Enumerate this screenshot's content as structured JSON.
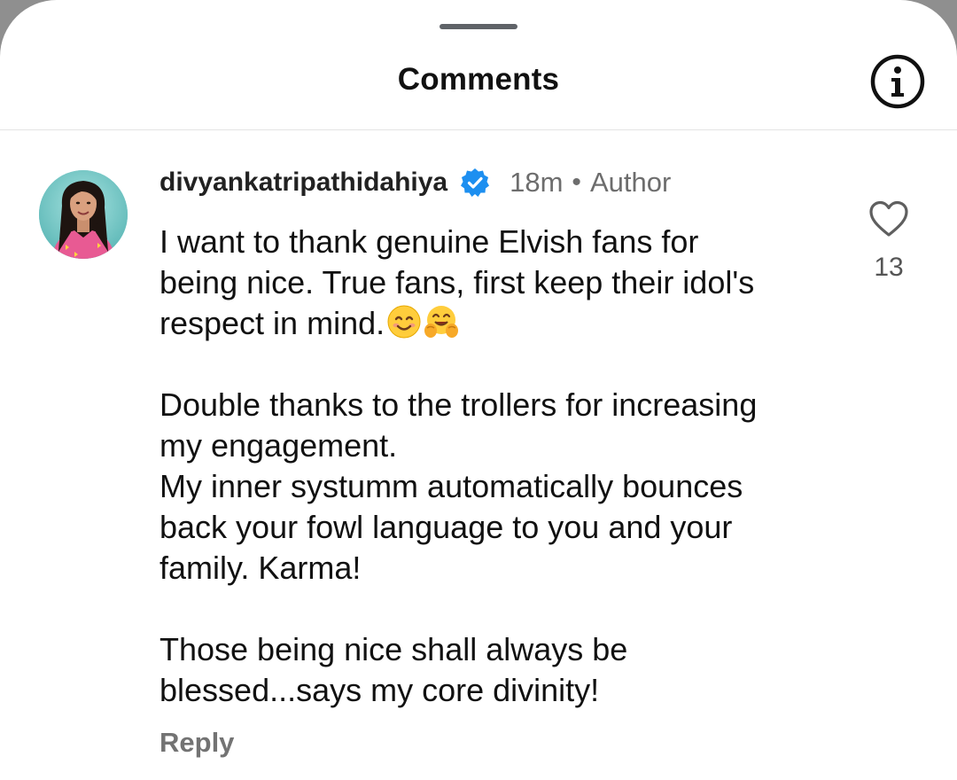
{
  "header": {
    "title": "Comments",
    "info_icon": "info-circle-icon"
  },
  "comment": {
    "username": "divyankatripathidahiya",
    "verified_icon": "verified-badge-icon",
    "time": "18m",
    "separator": "•",
    "role": "Author",
    "avatar_icon": "profile-avatar",
    "body": {
      "p1_line1": "I want to thank genuine Elvish fans for",
      "p1_line2": "being nice. True fans, first keep their idol's",
      "p1_line3": "respect in mind.",
      "emoji1": "smiling-face-icon",
      "emoji2": "hugging-face-icon",
      "p2_line1": "Double thanks to the trollers for increasing",
      "p2_line2": "my engagement.",
      "p2_line3": "My inner systumm automatically bounces",
      "p2_line4": "back your fowl language to you and your",
      "p2_line5": "family. Karma!",
      "p3_line1": "Those being nice shall always be",
      "p3_line2": "blessed...says my core divinity!"
    },
    "like_icon": "heart-icon",
    "like_count": "13",
    "reply_label": "Reply"
  },
  "colors": {
    "background": "#ffffff",
    "text_primary": "#111111",
    "text_secondary": "#6d6d6d",
    "verified_blue": "#1d8ff0",
    "divider": "#e4e4e4"
  }
}
